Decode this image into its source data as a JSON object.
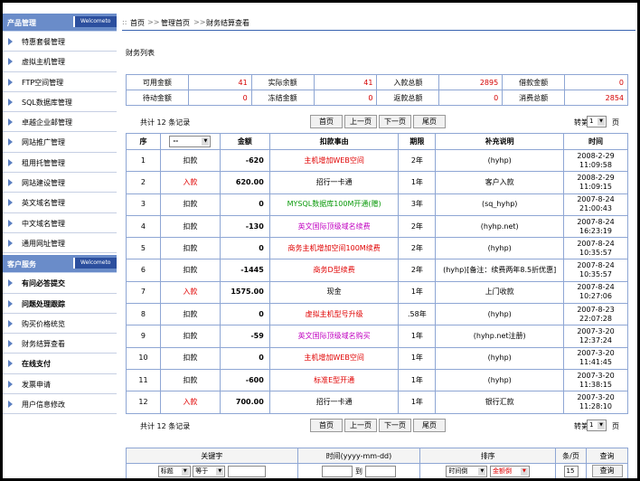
{
  "sidebar": {
    "product_section": {
      "title": "产品管理",
      "welcome": "Welcometo",
      "items": [
        {
          "label": "特惠套餐管理",
          "bold": false
        },
        {
          "label": "虚拟主机管理",
          "bold": false
        },
        {
          "label": "FTP空间管理",
          "bold": false
        },
        {
          "label": "SQL数据库管理",
          "bold": false
        },
        {
          "label": "卓越企业邮管理",
          "bold": false
        },
        {
          "label": "网站推广管理",
          "bold": false
        },
        {
          "label": "租用托管管理",
          "bold": false
        },
        {
          "label": "网站建设管理",
          "bold": false
        },
        {
          "label": "英文域名管理",
          "bold": false
        },
        {
          "label": "中文域名管理",
          "bold": false
        },
        {
          "label": "通用网址管理",
          "bold": false
        }
      ]
    },
    "service_section": {
      "title": "客户服务",
      "welcome": "Welcometo",
      "items": [
        {
          "label": "有问必答提交",
          "bold": true
        },
        {
          "label": "问题处理跟踪",
          "bold": true
        },
        {
          "label": "购买价格统览",
          "bold": false
        },
        {
          "label": "财务结算查看",
          "bold": false
        },
        {
          "label": "在线支付",
          "bold": true
        },
        {
          "label": "发票申请",
          "bold": false
        },
        {
          "label": "用户信息修改",
          "bold": false
        }
      ]
    }
  },
  "breadcrumb": {
    "items": [
      "首页",
      "管理首页",
      "财务结算查看"
    ],
    "separator": ">>"
  },
  "list_title": "财务列表",
  "summary": {
    "row1": [
      {
        "label": "可用金额",
        "value": "41"
      },
      {
        "label": "实际余额",
        "value": "41"
      },
      {
        "label": "入款总额",
        "value": "2895"
      },
      {
        "label": "借款金额",
        "value": "0"
      }
    ],
    "row2": [
      {
        "label": "待动金额",
        "value": "0"
      },
      {
        "label": "冻结金额",
        "value": "0"
      },
      {
        "label": "返款总额",
        "value": "0"
      },
      {
        "label": "消费总额",
        "value": "2854"
      }
    ]
  },
  "pager": {
    "count_text": "共计 12 条记录",
    "buttons": [
      "首页",
      "上一页",
      "下一页",
      "尾页"
    ],
    "goto_label": "转第",
    "page_value": "1",
    "page_unit": "页"
  },
  "table": {
    "headers": [
      "序",
      "--",
      "金额",
      "扣款事由",
      "期限",
      "补充说明",
      "时间"
    ],
    "rows": [
      {
        "no": "1",
        "type": "扣款",
        "type_color": "black",
        "amount": "-620",
        "reason": "主机增加WEB空间",
        "reason_color": "red",
        "term": "2年",
        "note": "(hyhp)",
        "date": "2008-2-29",
        "time": "11:09:58"
      },
      {
        "no": "2",
        "type": "入款",
        "type_color": "red",
        "amount": "620.00",
        "reason": "招行一卡通",
        "reason_color": "black",
        "term": "1年",
        "note": "客户入款",
        "date": "2008-2-29",
        "time": "11:09:15"
      },
      {
        "no": "3",
        "type": "扣款",
        "type_color": "black",
        "amount": "0",
        "reason": "MYSQL数据库100M开通(赠)",
        "reason_color": "green",
        "term": "3年",
        "note": "(sq_hyhp)",
        "date": "2007-8-24",
        "time": "21:00:43"
      },
      {
        "no": "4",
        "type": "扣款",
        "type_color": "black",
        "amount": "-130",
        "reason": "英文国际顶级域名续费",
        "reason_color": "magenta",
        "term": "2年",
        "note": "(hyhp.net)",
        "date": "2007-8-24",
        "time": "16:23:19"
      },
      {
        "no": "5",
        "type": "扣款",
        "type_color": "black",
        "amount": "0",
        "reason": "商务主机增加空间100M续费",
        "reason_color": "red",
        "term": "2年",
        "note": "(hyhp)",
        "date": "2007-8-24",
        "time": "10:35:57"
      },
      {
        "no": "6",
        "type": "扣款",
        "type_color": "black",
        "amount": "-1445",
        "reason": "商务D型续费",
        "reason_color": "red",
        "term": "2年",
        "note": "(hyhp)[备注：续费两年8.5折优惠]",
        "date": "2007-8-24",
        "time": "10:35:57"
      },
      {
        "no": "7",
        "type": "入款",
        "type_color": "red",
        "amount": "1575.00",
        "reason": "现金",
        "reason_color": "black",
        "term": "1年",
        "note": "上门收款",
        "date": "2007-8-24",
        "time": "10:27:06"
      },
      {
        "no": "8",
        "type": "扣款",
        "type_color": "black",
        "amount": "0",
        "reason": "虚拟主机型号升级",
        "reason_color": "red",
        "term": ".58年",
        "note": "(hyhp)",
        "date": "2007-8-23",
        "time": "22:07:28"
      },
      {
        "no": "9",
        "type": "扣款",
        "type_color": "black",
        "amount": "-59",
        "reason": "英文国际顶级域名购买",
        "reason_color": "magenta",
        "term": "1年",
        "note": "(hyhp.net注册)",
        "date": "2007-3-20",
        "time": "12:37:24"
      },
      {
        "no": "10",
        "type": "扣款",
        "type_color": "black",
        "amount": "0",
        "reason": "主机增加WEB空间",
        "reason_color": "red",
        "term": "1年",
        "note": "(hyhp)",
        "date": "2007-3-20",
        "time": "11:41:45"
      },
      {
        "no": "11",
        "type": "扣款",
        "type_color": "black",
        "amount": "-600",
        "reason": "标准E型开通",
        "reason_color": "red",
        "term": "1年",
        "note": "(hyhp)",
        "date": "2007-3-20",
        "time": "11:38:15"
      },
      {
        "no": "12",
        "type": "入款",
        "type_color": "red",
        "amount": "700.00",
        "reason": "招行一卡通",
        "reason_color": "black",
        "term": "1年",
        "note": "银行汇款",
        "date": "2007-3-20",
        "time": "11:28:10"
      }
    ]
  },
  "search": {
    "headers": [
      "关键字",
      "时间(yyyy-mm-dd)",
      "排序",
      "条/页",
      "查询"
    ],
    "field_select": "标题",
    "op_select": "等于",
    "date_to": "到",
    "sort_field": "时间倒",
    "sort_field2": "金额倒",
    "per_page": "15",
    "button": "查询"
  },
  "colors": {
    "sidebar_header": "#6a8cc9",
    "welcome_tag": "#2c4f9e",
    "border": "#8ea6d4",
    "value_red": "#d40000"
  }
}
